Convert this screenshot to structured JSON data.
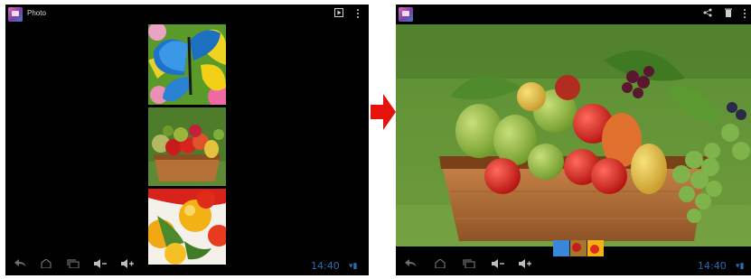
{
  "left_screen": {
    "app_title": "Photo",
    "actionbar_icons": [
      "slideshow-icon",
      "overflow-menu-icon"
    ],
    "filmstrip": [
      {
        "name": "butterfly-photo"
      },
      {
        "name": "fruit-basket-photo"
      },
      {
        "name": "tomatoes-photo"
      }
    ],
    "navbar": {
      "icons": [
        "back-icon",
        "home-icon",
        "recent-apps-icon",
        "volume-down-icon",
        "volume-up-icon"
      ],
      "clock": "14:40"
    }
  },
  "right_screen": {
    "actionbar_icons": [
      "share-icon",
      "delete-icon",
      "overflow-menu-icon"
    ],
    "photo": {
      "name": "fruit-basket-photo"
    },
    "navbar": {
      "icons": [
        "back-icon",
        "home-icon",
        "recent-apps-icon",
        "volume-down-icon",
        "volume-up-icon"
      ],
      "clock": "14:40"
    }
  },
  "arrow": {
    "color": "#e8120c"
  },
  "colors": {
    "clock": "#2d6bb0",
    "screen_bg": "#000000"
  }
}
